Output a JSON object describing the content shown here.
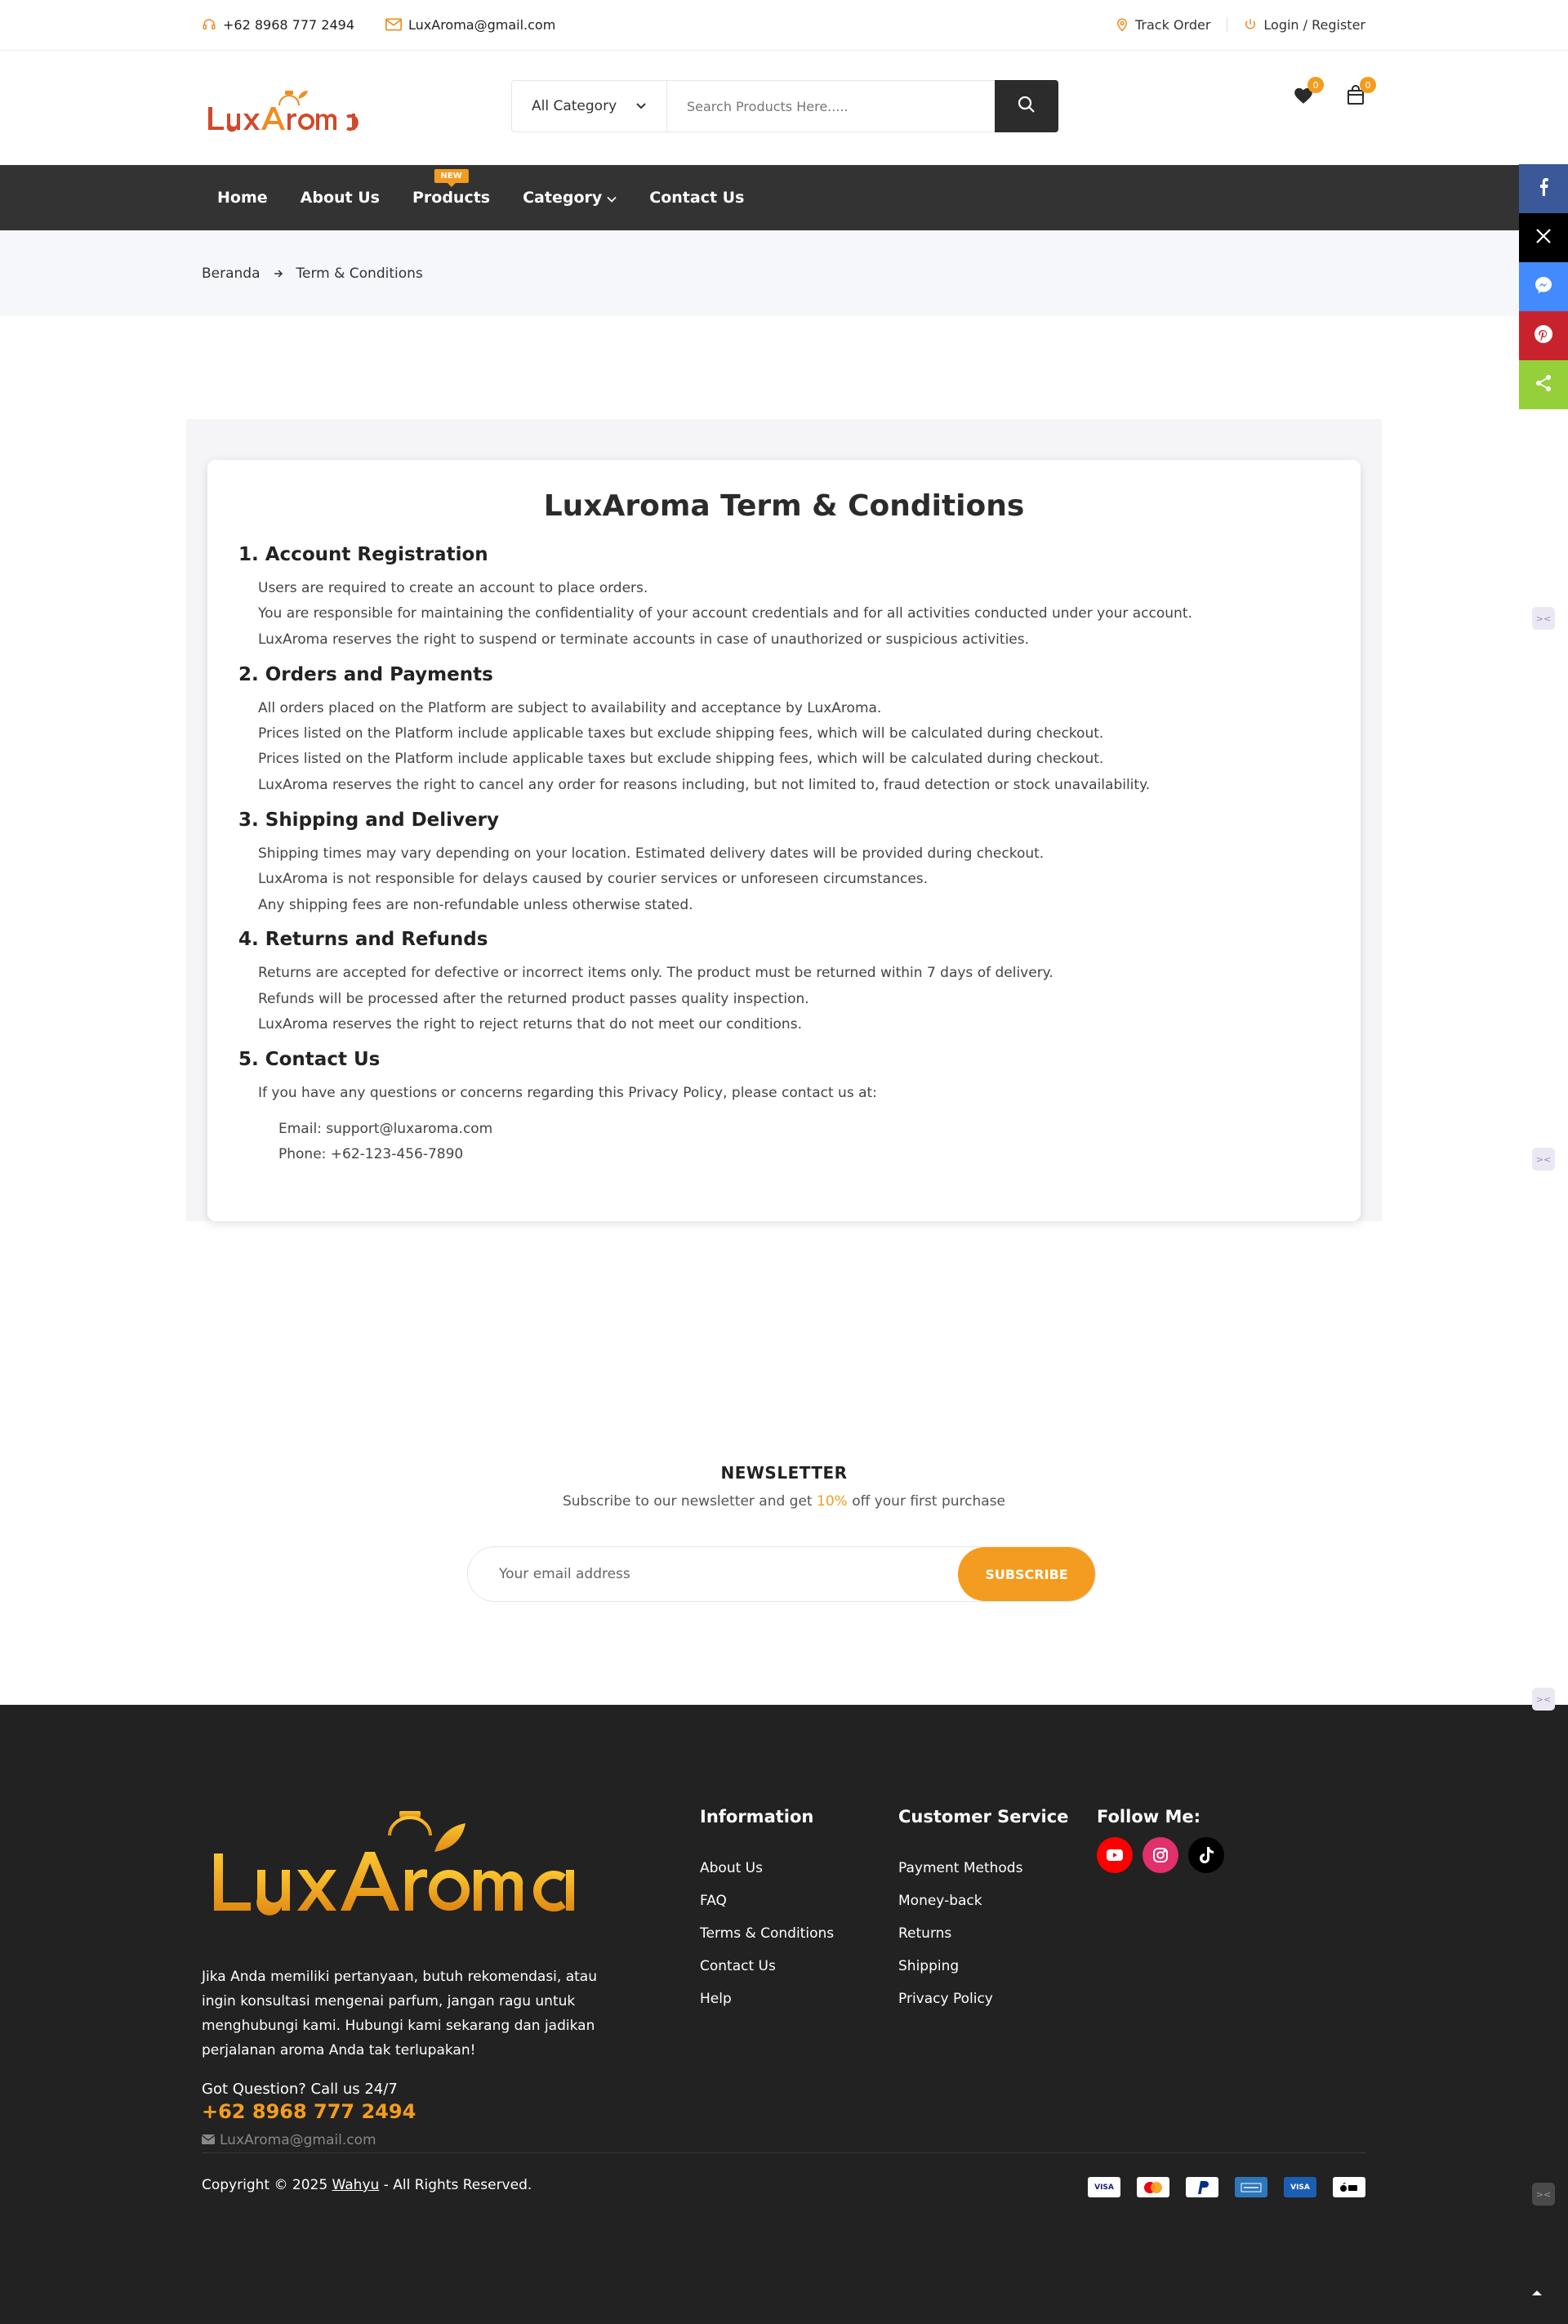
{
  "topbar": {
    "phone": "+62 8968 777 2494",
    "email": "LuxAroma@gmail.com",
    "track_order": "Track Order",
    "login_register": "Login / Register"
  },
  "header": {
    "category_label": "All Category",
    "search_placeholder": "Search Products Here.....",
    "wishlist_count": "0",
    "cart_count": "0"
  },
  "nav": {
    "items": [
      {
        "label": "Home"
      },
      {
        "label": "About Us"
      },
      {
        "label": "Products",
        "badge": "NEW"
      },
      {
        "label": "Category"
      },
      {
        "label": "Contact Us"
      }
    ]
  },
  "breadcrumb": {
    "home": "Beranda",
    "current": "Term & Conditions"
  },
  "terms": {
    "title": "LuxAroma Term & Conditions",
    "sections": [
      {
        "heading": "1. Account Registration",
        "lines": [
          "Users are required to create an account to place orders.",
          "You are responsible for maintaining the confidentiality of your account credentials and for all activities conducted under your account.",
          "LuxAroma reserves the right to suspend or terminate accounts in case of unauthorized or suspicious activities."
        ]
      },
      {
        "heading": "2. Orders and Payments",
        "lines": [
          "All orders placed on the Platform are subject to availability and acceptance by LuxAroma.",
          "Prices listed on the Platform include applicable taxes but exclude shipping fees, which will be calculated during checkout.",
          "Prices listed on the Platform include applicable taxes but exclude shipping fees, which will be calculated during checkout.",
          "LuxAroma reserves the right to cancel any order for reasons including, but not limited to, fraud detection or stock unavailability."
        ]
      },
      {
        "heading": "3. Shipping and Delivery",
        "lines": [
          "Shipping times may vary depending on your location. Estimated delivery dates will be provided during checkout.",
          "LuxAroma is not responsible for delays caused by courier services or unforeseen circumstances.",
          "Any shipping fees are non-refundable unless otherwise stated."
        ]
      },
      {
        "heading": "4. Returns and Refunds",
        "lines": [
          "Returns are accepted for defective or incorrect items only. The product must be returned within 7 days of delivery.",
          "Refunds will be processed after the returned product passes quality inspection.",
          "LuxAroma reserves the right to reject returns that do not meet our conditions."
        ]
      },
      {
        "heading": "5. Contact Us",
        "lines": [
          "If you have any questions or concerns regarding this Privacy Policy, please contact us at:"
        ]
      }
    ],
    "contact_email": "Email: support@luxaroma.com",
    "contact_phone": "Phone: +62-123-456-7890"
  },
  "newsletter": {
    "title": "NEWSLETTER",
    "subtitle_before": "Subscribe to our newsletter and get ",
    "subtitle_highlight": "10%",
    "subtitle_after": " off your first purchase",
    "placeholder": "Your email address",
    "button": "SUBSCRIBE"
  },
  "footer": {
    "description": "Jika Anda memiliki pertanyaan, butuh rekomendasi, atau ingin konsultasi mengenai parfum, jangan ragu untuk menghubungi kami. Hubungi kami sekarang dan jadikan perjalanan aroma Anda tak terlupakan!",
    "question": "Got Question? Call us 24/7",
    "phone": "+62 8968 777 2494",
    "email": "LuxAroma@gmail.com",
    "information": {
      "title": "Information",
      "links": [
        "About Us",
        "FAQ",
        "Terms & Conditions",
        "Contact Us",
        "Help"
      ]
    },
    "customer_service": {
      "title": "Customer Service",
      "links": [
        "Payment Methods",
        "Money-back",
        "Returns",
        "Shipping",
        "Privacy Policy"
      ]
    },
    "follow": {
      "title": "Follow Me:",
      "icons": [
        "youtube-icon",
        "instagram-icon",
        "tiktok-icon"
      ]
    },
    "copyright_before": "Copyright © 2025 ",
    "copyright_author": "Wahyu",
    "copyright_after": " - All Rights Reserved.",
    "payment_icons": [
      "visa-icon",
      "mastercard-icon",
      "paypal-icon",
      "amex-icon",
      "visa-icon",
      "apple-pay-icon"
    ]
  },
  "colors": {
    "accent": "#f39c1f",
    "nav_bg": "#333333",
    "footer_bg": "#222222",
    "facebook": "#3b5998",
    "x": "#000000",
    "messenger": "#448aff",
    "pinterest": "#c8232c",
    "share": "#95d03a"
  }
}
